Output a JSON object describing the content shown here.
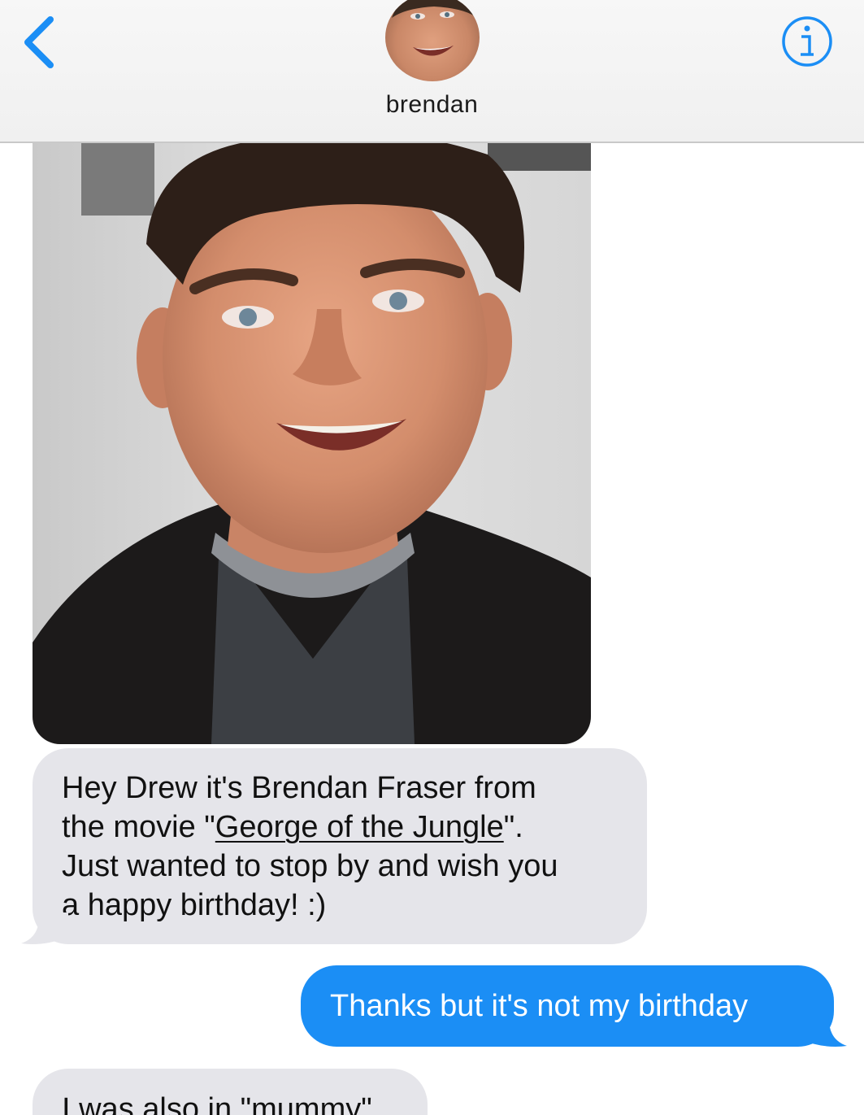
{
  "header": {
    "back_icon": "chevron-left-icon",
    "contact_name": "brendan",
    "info_icon": "info-icon",
    "accent_color": "#1b8ef5"
  },
  "messages": [
    {
      "type": "photo",
      "direction": "incoming"
    },
    {
      "type": "text",
      "direction": "incoming",
      "lines": [
        {
          "text": "Hey Drew it's Brendan Fraser from"
        },
        {
          "prefix": "the movie \"",
          "link": "George of the Jungle",
          "suffix": "\"."
        },
        {
          "text": "Just wanted to stop by and wish you"
        },
        {
          "text": "a happy birthday! :)"
        }
      ]
    },
    {
      "type": "text",
      "direction": "outgoing",
      "text": "Thanks but it's not my birthday"
    },
    {
      "type": "text",
      "direction": "incoming",
      "text": "I was also in \"mummy\""
    }
  ],
  "colors": {
    "incoming_bubble": "#e5e5ea",
    "outgoing_bubble": "#1b8ef5"
  }
}
